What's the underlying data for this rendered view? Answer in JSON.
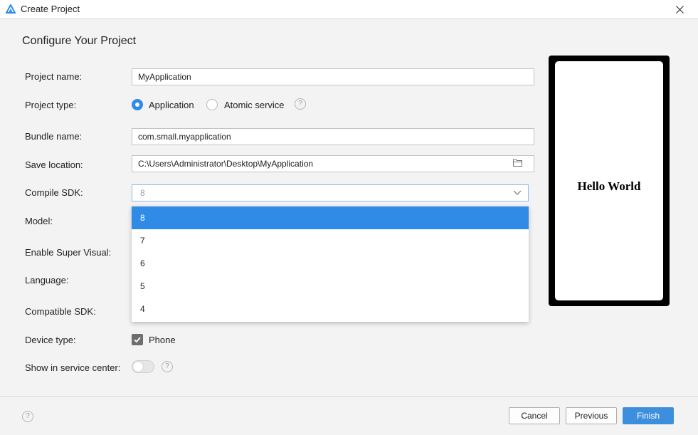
{
  "window": {
    "title": "Create Project"
  },
  "heading": "Configure Your Project",
  "form": {
    "project_name": {
      "label": "Project name:",
      "value": "MyApplication"
    },
    "project_type": {
      "label": "Project type:",
      "options": [
        "Application",
        "Atomic service"
      ],
      "selected": "Application"
    },
    "bundle_name": {
      "label": "Bundle name:",
      "value": "com.small.myapplication"
    },
    "save_location": {
      "label": "Save location:",
      "value": "C:\\Users\\Administrator\\Desktop\\MyApplication"
    },
    "compile_sdk": {
      "label": "Compile SDK:",
      "value": "8",
      "options": [
        "8",
        "7",
        "6",
        "5",
        "4"
      ],
      "highlighted": "8"
    },
    "model": {
      "label": "Model:"
    },
    "enable_super_visual": {
      "label": "Enable Super Visual:"
    },
    "language": {
      "label": "Language:"
    },
    "compatible_sdk": {
      "label": "Compatible SDK:"
    },
    "device_type": {
      "label": "Device type:",
      "option": "Phone",
      "checked": true
    },
    "show_in_service_center": {
      "label": "Show in service center:",
      "on": false
    }
  },
  "preview": {
    "text": "Hello World"
  },
  "help_glyph": "?",
  "footer": {
    "cancel": "Cancel",
    "previous": "Previous",
    "finish": "Finish"
  },
  "colors": {
    "accent": "#2f8be6",
    "primary_button": "#3d8fde"
  }
}
